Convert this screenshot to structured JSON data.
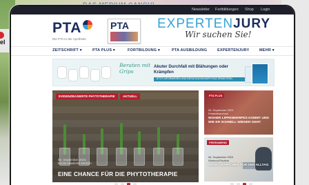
{
  "background": {
    "topbar_text": "DAS MEDIUM  CANCHI",
    "left_badge_text": "el"
  },
  "utility": {
    "items": [
      "Newsletter",
      "Fortbildungen",
      "Shop",
      "Login"
    ]
  },
  "logo": {
    "brand": "PTA",
    "subtitle": "Die PTA in der Apotheke",
    "magazine_title": "PTA"
  },
  "promo": {
    "experten": "EXPERTEN",
    "jury": "JURY",
    "tagline": "Wir suchen Sie!"
  },
  "nav": {
    "items": [
      "ZEITSCHRIFT",
      "PTA PLUS",
      "FORTBILDUNG",
      "PTA AUSBILDUNG",
      "EXPERTENJURY",
      "MEHR"
    ]
  },
  "ad": {
    "script": "Beraten mit Grips",
    "headline": "Akuter Durchfall mit Blähungen oder Krämpfen",
    "bar_text": "JETZT INFORMIEREN UND BERATUNGSKOMPETENZ ERWEITERN"
  },
  "hero": {
    "tag_primary": "EVIDENZBASIERTE PHYTOTHERAPIE",
    "tag_secondary": "AKTUELL",
    "date": "06. September 2023",
    "subtitle": "Evidenzbasierte Medizin",
    "title": "EINE CHANCE FÜR DIE PHYTOTHERAPIE"
  },
  "side_cards": [
    {
      "tag": "PTA PLUS",
      "date": "06. September 2023",
      "category": "Fettstoffwechsel",
      "headline": "WOHER LIPPENHERPES KOMMT UND WIE ER SCHNELL WIEDER GEHT"
    },
    {
      "tag": "FEIERABEND",
      "date": "06. September 2023",
      "category": "Workout-Routine",
      "headline": "SPORT-HÄPPCHEN FÜR DEN ALLTAG"
    }
  ],
  "slider": {
    "count": 4,
    "active_index": 2
  },
  "colors": {
    "brand_navy": "#1b2b5a",
    "accent_red": "#b31f2f",
    "accent_blue": "#36a2d6"
  }
}
